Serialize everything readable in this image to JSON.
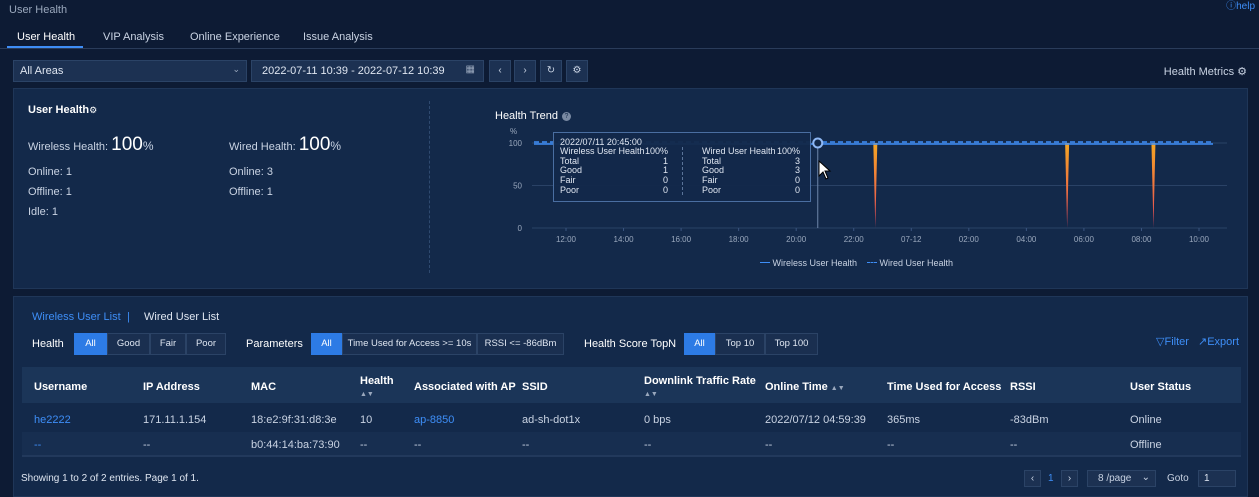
{
  "page": {
    "title": "User Health",
    "help": "ⓘhelp"
  },
  "tabs": [
    {
      "label": "User Health",
      "active": true
    },
    {
      "label": "VIP Analysis"
    },
    {
      "label": "Online Experience"
    },
    {
      "label": "Issue Analysis"
    }
  ],
  "toolbar": {
    "area_select": "All Areas",
    "date_range": "2022-07-11 10:39  -  2022-07-12 10:39",
    "prev_icon": "chevron-left-icon",
    "next_icon": "chevron-right-icon",
    "refresh_icon": "refresh-icon",
    "settings_icon": "gear-icon",
    "health_metrics": "Health Metrics"
  },
  "summary": {
    "title": "User Health",
    "wireless_label": "Wireless Health:",
    "wireless_value": "100",
    "wireless_unit": "%",
    "wired_label": "Wired Health:",
    "wired_value": "100",
    "wired_unit": "%",
    "wireless_online": "Online: 1",
    "wireless_offline": "Offline: 1",
    "wireless_idle": "Idle: 1",
    "wired_online": "Online: 3",
    "wired_offline": "Offline: 1"
  },
  "trend": {
    "title": "Health Trend",
    "tooltip": {
      "time": "2022/07/11 20:45:00",
      "wireless": [
        {
          "k": "Wireless User Health",
          "v": "100%"
        },
        {
          "k": "Total",
          "v": "1"
        },
        {
          "k": "Good",
          "v": "1"
        },
        {
          "k": "Fair",
          "v": "0"
        },
        {
          "k": "Poor",
          "v": "0"
        }
      ],
      "wired": [
        {
          "k": "Wired User Health",
          "v": "100%"
        },
        {
          "k": "Total",
          "v": "3"
        },
        {
          "k": "Good",
          "v": "3"
        },
        {
          "k": "Fair",
          "v": "0"
        },
        {
          "k": "Poor",
          "v": "0"
        }
      ]
    }
  },
  "chart_data": {
    "type": "line",
    "title": "Health Trend",
    "ylabel": "%",
    "ylim": [
      0,
      100
    ],
    "y_ticks": [
      "100",
      "50",
      "0"
    ],
    "x_ticks": [
      "12:00",
      "14:00",
      "16:00",
      "18:00",
      "20:00",
      "22:00",
      "07-12",
      "02:00",
      "04:00",
      "06:00",
      "08:00",
      "10:00"
    ],
    "series": [
      {
        "name": "Wireless User Health",
        "style": "solid",
        "color": "#3e8ef7"
      },
      {
        "name": "Wired User Health",
        "style": "dashed",
        "color": "#3e8ef7"
      }
    ],
    "dips": [
      {
        "time": "22:45",
        "value": 0
      },
      {
        "time": "05:25",
        "value": 0
      },
      {
        "time": "08:25",
        "value": 0
      }
    ],
    "hover_time": "20:45",
    "legend_position": "bottom"
  },
  "users": {
    "subtabs": [
      "Wireless User List",
      "Wired User List"
    ],
    "health_label": "Health",
    "health_filters": [
      "All",
      "Good",
      "Fair",
      "Poor"
    ],
    "params_label": "Parameters",
    "param_filters": [
      "All",
      "Time Used for Access >= 10s",
      "RSSI <= -86dBm"
    ],
    "topn_label": "Health Score TopN",
    "topn_filters": [
      "All",
      "Top 10",
      "Top 100"
    ],
    "filter": "Filter",
    "export": "Export",
    "columns": [
      "Username",
      "IP Address",
      "MAC",
      "Health",
      "Associated with AP",
      "SSID",
      "Downlink Traffic Rate",
      "Online Time",
      "Time Used for Access",
      "RSSI",
      "User Status"
    ],
    "rows": [
      [
        "he2222",
        "171.11.1.154",
        "18:e2:9f:31:d8:3e",
        "10",
        "ap-8850",
        "ad-sh-dot1x",
        "0 bps",
        "2022/07/12 04:59:39",
        "365ms",
        "-83dBm",
        "Online"
      ],
      [
        "--",
        "--",
        "b0:44:14:ba:73:90",
        "--",
        "--",
        "--",
        "--",
        "--",
        "--",
        "--",
        "Offline"
      ]
    ],
    "footer": "Showing 1 to 2 of 2 entries.  Page 1 of 1.",
    "page": "1",
    "per_page": "8 /page",
    "goto_label": "Goto",
    "goto_value": "1"
  },
  "colors": {
    "accent": "#3e8ef7",
    "panel": "#13294a",
    "background": "#0d1b34",
    "dip_top": "#f5a623",
    "dip_bottom": "#e8445a"
  }
}
